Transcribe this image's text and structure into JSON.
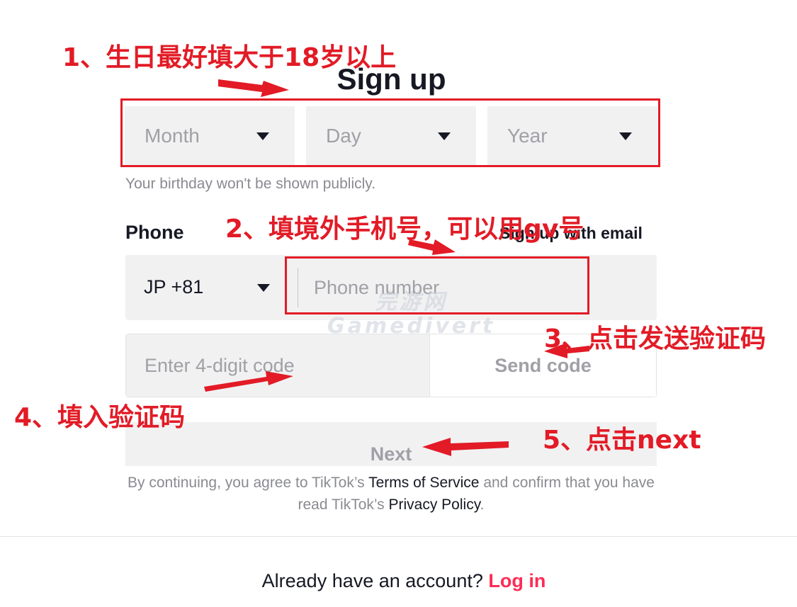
{
  "title": "Sign up",
  "birthday": {
    "month_placeholder": "Month",
    "day_placeholder": "Day",
    "year_placeholder": "Year",
    "hint": "Your birthday won't be shown publicly."
  },
  "phone": {
    "label": "Phone",
    "email_link": "Sign up with email",
    "country_code": "JP +81",
    "number_placeholder": "Phone number"
  },
  "verification": {
    "code_placeholder": "Enter 4-digit code",
    "send_code_label": "Send code"
  },
  "next_label": "Next",
  "legal": {
    "prefix": "By continuing, you agree to TikTok’s ",
    "terms_link": "Terms of Service",
    "middle": " and confirm that you have read TikTok’s ",
    "privacy_link": "Privacy Policy",
    "suffix": "."
  },
  "login": {
    "prompt": "Already have an account? ",
    "link": "Log in"
  },
  "watermark": {
    "line1": "完游网",
    "line2": "Gamedivert"
  },
  "annotations": {
    "step1": "1、生日最好填大于18岁以上",
    "step2": "2、填境外手机号，可以用gv号",
    "step3": "3、点击发送验证码",
    "step4": "4、填入验证码",
    "step5": "5、点击next"
  },
  "colors": {
    "annotation_red": "#e21b26",
    "brand_pink": "#fe2c55",
    "field_gray": "#f1f1f2",
    "text_dark": "#161823"
  }
}
